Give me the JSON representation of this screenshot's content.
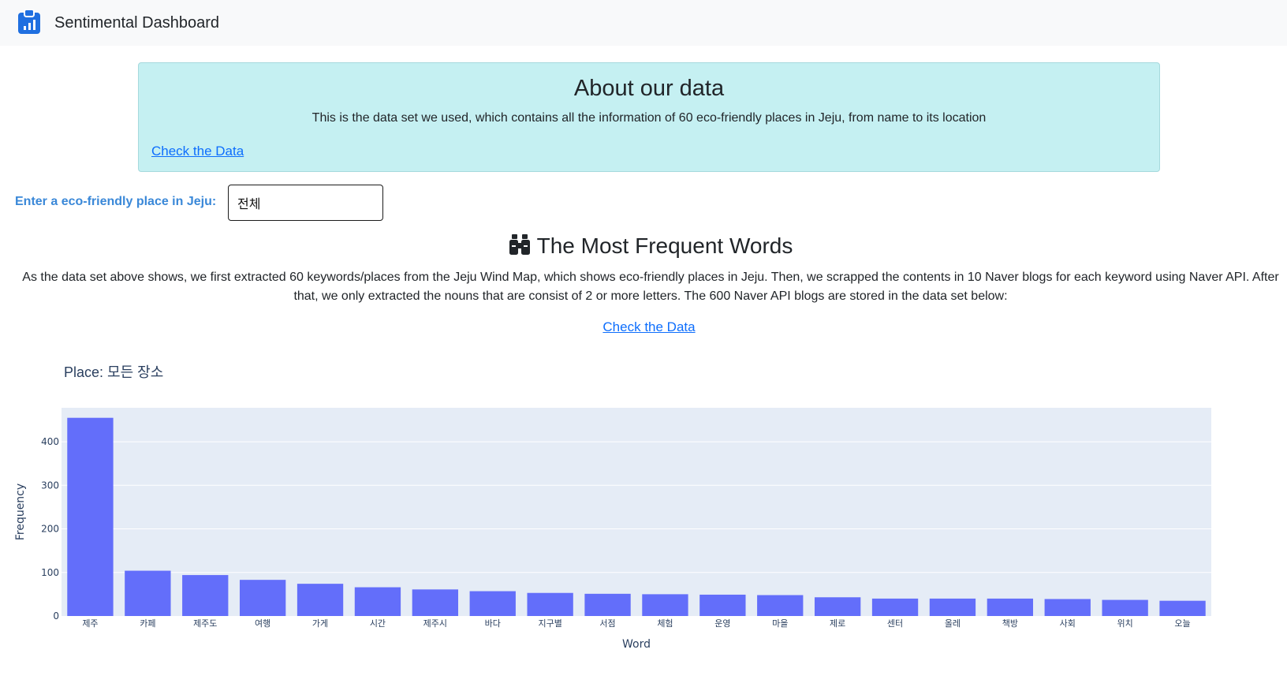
{
  "navbar": {
    "title": "Sentimental Dashboard",
    "logo_icon": "clipboard-chart-icon",
    "brand_color": "#1f6fe0"
  },
  "about": {
    "title": "About our data",
    "text": "This is the data set we used, which contains all the information of 60 eco-friendly places in Jeju, from name to its location",
    "link": "Check the Data",
    "bg_color": "#c5f0f2"
  },
  "place_input": {
    "label": "Enter a eco-friendly place in Jeju:",
    "value": "전체"
  },
  "frequent": {
    "icon": "binoculars-icon",
    "title": "The Most Frequent Words",
    "text_line1": "As the data set above shows, we first extracted 60 keywords/places from the Jeju Wind Map, which shows eco-friendly places in Jeju. Then, we scrapped the contents in 10 Naver blogs for each keyword using Naver API. After",
    "text_line2": "that, we only extracted the nouns that are consist of 2 or more letters. The 600 Naver API blogs are stored in the data set below:",
    "link": "Check the Data"
  },
  "chart_title": "Place: 모든 장소",
  "chart_data": {
    "type": "bar",
    "title": "Place: 모든 장소",
    "xlabel": "Word",
    "ylabel": "Frequency",
    "categories": [
      "제주",
      "카페",
      "제주도",
      "여행",
      "가게",
      "시간",
      "제주시",
      "바다",
      "지구별",
      "서점",
      "체험",
      "운영",
      "마을",
      "제로",
      "센터",
      "올레",
      "책방",
      "사회",
      "위치",
      "오늘"
    ],
    "values": [
      455,
      104,
      94,
      83,
      74,
      66,
      61,
      57,
      53,
      51,
      50,
      49,
      48,
      43,
      40,
      40,
      40,
      39,
      37,
      35
    ],
    "ylim": [
      0,
      478
    ],
    "yticks": [
      0,
      100,
      200,
      300,
      400
    ],
    "bar_color": "#636efa",
    "plot_bg": "#e5ecf6",
    "grid": true,
    "legend": "none"
  }
}
